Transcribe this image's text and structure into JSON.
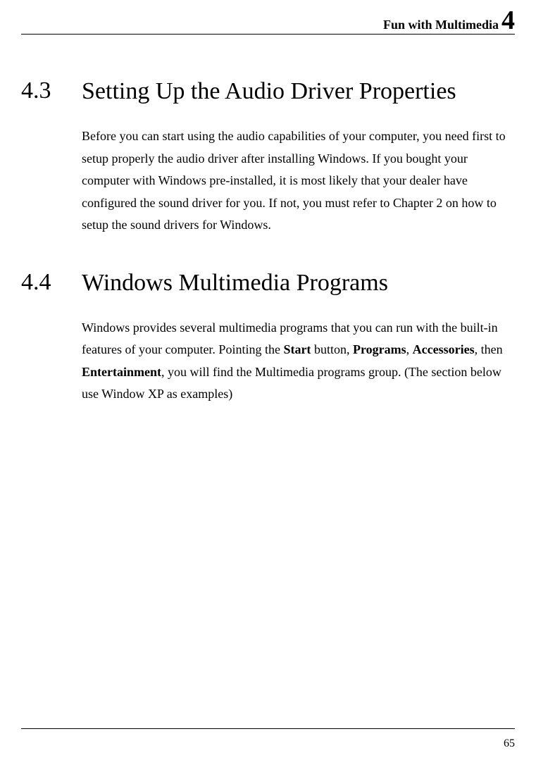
{
  "header": {
    "title": "Fun with Multimedia",
    "chapter": "4"
  },
  "sections": [
    {
      "number": "4.3",
      "title": "Setting Up the Audio Driver Properties",
      "body_plain": "Before you can start using the audio capabilities of your computer, you need first to setup properly the audio driver after installing Windows. If you bought your computer with Windows pre-installed, it is most likely that your dealer have configured the sound driver for you. If not, you must refer to Chapter 2 on how to setup the sound drivers for Windows."
    },
    {
      "number": "4.4",
      "title": "Windows Multimedia Programs",
      "body_parts": {
        "p1": "Windows provides several multimedia programs that you can run with the built-in features of your computer. Pointing the ",
        "b1": "Start",
        "p2": " button, ",
        "b2": "Programs",
        "p3": ", ",
        "b3": "Accessories",
        "p4": ", then ",
        "b4": "Entertainment",
        "p5": ", you will find the Multimedia programs group. (The section below use Window XP as examples)"
      }
    }
  ],
  "page_number": "65"
}
